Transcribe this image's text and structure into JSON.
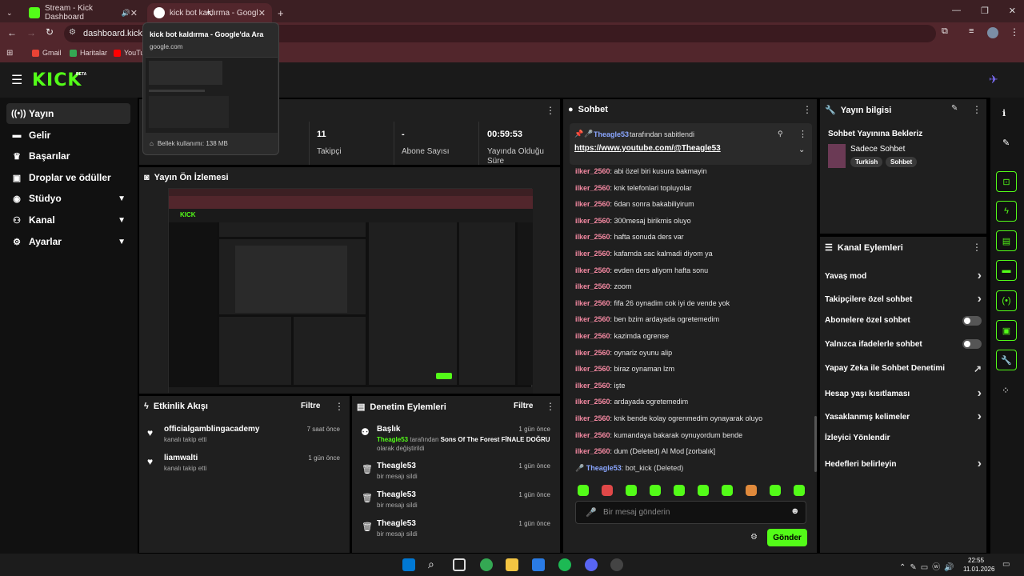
{
  "browser": {
    "tabs": [
      {
        "label": "Stream - Kick Dashboard"
      },
      {
        "label": "kick bot kaldırma - Google'da Ara"
      }
    ],
    "url": "dashboard.kick.co",
    "bookmarks": [
      "Gmail",
      "Haritalar",
      "YouTu"
    ],
    "tooltip": {
      "title": "kick bot kaldırma - Google'da Ara",
      "domain": "google.com",
      "memory": "Bellek kullanımı: 138 MB"
    }
  },
  "header": {
    "logo": "KICK",
    "beta": "BETA"
  },
  "sidebar": {
    "items": [
      {
        "label": "Yayın",
        "icon": "broadcast-icon"
      },
      {
        "label": "Gelir",
        "icon": "money-icon"
      },
      {
        "label": "Başarılar",
        "icon": "trophy-icon"
      },
      {
        "label": "Droplar ve ödüller",
        "icon": "gift-icon"
      },
      {
        "label": "Stüdyo",
        "icon": "palette-icon"
      },
      {
        "label": "Kanal",
        "icon": "users-icon"
      },
      {
        "label": "Ayarlar",
        "icon": "gear-icon"
      }
    ]
  },
  "stats": [
    {
      "value": "11",
      "label": "Takipçi"
    },
    {
      "value": "-",
      "label": "Abone Sayısı"
    },
    {
      "value": "00:59:53",
      "label": "Yayında Olduğu Süre"
    }
  ],
  "preview": {
    "title": "Yayın Ön İzlemesi"
  },
  "activity": {
    "title": "Etkinlik Akışı",
    "filter": "Filtre",
    "items": [
      {
        "name": "officialgamblingacademy",
        "sub": "kanalı takip etti",
        "time": "7 saat önce"
      },
      {
        "name": "liamwalti",
        "sub": "kanalı takip etti",
        "time": "1 gün önce"
      }
    ]
  },
  "moderation": {
    "title": "Denetim Eylemleri",
    "filter": "Filtre",
    "items": [
      {
        "name": "Başlık",
        "user": "Theagle53",
        "mid": " tarafından ",
        "bold": "Sons Of The Forest FİNALE DOĞRU",
        "tail": "olarak değiştirildi",
        "time": "1 gün önce"
      },
      {
        "name": "Theagle53",
        "sub": "bir mesajı sildi",
        "time": "1 gün önce"
      },
      {
        "name": "Theagle53",
        "sub": "bir mesajı sildi",
        "time": "1 gün önce"
      },
      {
        "name": "Theagle53",
        "sub": "bir mesajı sildi",
        "time": "1 gün önce"
      }
    ]
  },
  "chat": {
    "title": "Sohbet",
    "pinned": {
      "user": "Theagle53",
      "by": "tarafından sabitlendi",
      "link": "https://www.youtube.com/@Theagle53"
    },
    "messages": [
      {
        "user": "ilker_2560",
        "text": ": abi özel biri kusura bakmayin"
      },
      {
        "user": "ilker_2560",
        "text": ": knk telefonlari topluyolar"
      },
      {
        "user": "ilker_2560",
        "text": ": 6dan sonra bakabiliyirum"
      },
      {
        "user": "ilker_2560",
        "text": ": 300mesaj birikmis oluyo"
      },
      {
        "user": "ilker_2560",
        "text": ": hafta sonuda ders var"
      },
      {
        "user": "ilker_2560",
        "text": ": kafamda sac kalmadi diyom ya"
      },
      {
        "user": "ilker_2560",
        "text": ": evden ders aliyom hafta sonu"
      },
      {
        "user": "ilker_2560",
        "text": ": zoom"
      },
      {
        "user": "ilker_2560",
        "text": ": fifa 26 oynadim cok iyi de vende yok"
      },
      {
        "user": "ilker_2560",
        "text": ": ben bzim ardayada ogretemedim"
      },
      {
        "user": "ilker_2560",
        "text": ": kazimda ogrense"
      },
      {
        "user": "ilker_2560",
        "text": ": oynariz oyunu alip"
      },
      {
        "user": "ilker_2560",
        "text": ": biraz oynaman lzm"
      },
      {
        "user": "ilker_2560",
        "text": ": işte"
      },
      {
        "user": "ilker_2560",
        "text": ": ardayada ogretemedim"
      },
      {
        "user": "ilker_2560",
        "text": ": knk bende kolay ogrenmedim oynayarak oluyo"
      },
      {
        "user": "ilker_2560",
        "text": ": kumandaya bakarak oynuyordum bende"
      },
      {
        "user": "ilker_2560",
        "text": ": dum (Deleted) AI Mod [zorbalık]"
      }
    ],
    "last": {
      "user": "Theagle53",
      "text": ": bot_kick (Deleted)"
    },
    "placeholder": "Bir mesaj gönderin",
    "send": "Gönder"
  },
  "stream_info": {
    "title": "Yayın bilgisi",
    "heading": "Sohbet Yayınına Bekleriz",
    "category": "Sadece Sohbet",
    "tags": [
      "Turkish",
      "Sohbet"
    ]
  },
  "channel_actions": {
    "title": "Kanal Eylemleri",
    "items": [
      {
        "label": "Yavaş mod",
        "kind": "arrow"
      },
      {
        "label": "Takipçilere özel sohbet",
        "kind": "arrow"
      },
      {
        "label": "Abonelere özel sohbet",
        "kind": "toggle"
      },
      {
        "label": "Yalnızca ifadelerle sohbet",
        "kind": "toggle"
      },
      {
        "label": "Yapay Zeka ile Sohbet Denetimi",
        "kind": "external"
      },
      {
        "label": "Hesap yaşı kısıtlaması",
        "kind": "arrow"
      },
      {
        "label": "Yasaklanmış kelimeler",
        "kind": "arrow"
      },
      {
        "label": "İzleyici Yönlendir",
        "kind": "none"
      },
      {
        "label": "Hedefleri belirleyin",
        "kind": "arrow"
      }
    ]
  },
  "taskbar": {
    "time": "22:55",
    "date": "11.01.2026"
  }
}
